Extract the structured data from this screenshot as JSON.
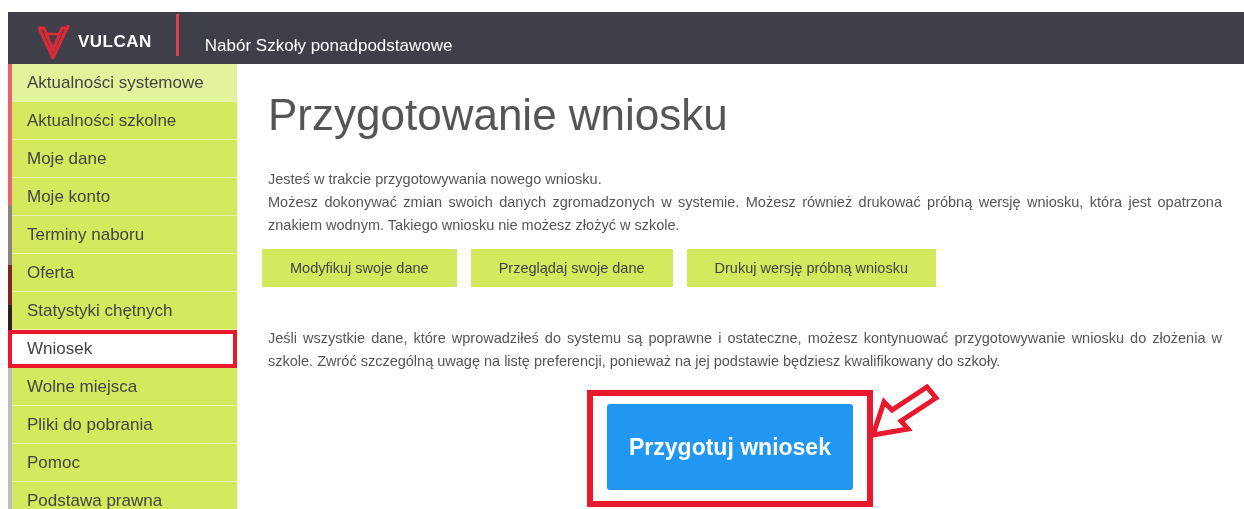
{
  "header": {
    "logo": "VULCAN",
    "title": "Nabór Szkoły ponadpodstawowe"
  },
  "sidebar": {
    "items": [
      {
        "label": "Aktualności systemowe",
        "selected": false,
        "kind": "news"
      },
      {
        "label": "Aktualności szkolne",
        "selected": false,
        "kind": "link"
      },
      {
        "label": "Moje dane",
        "selected": false,
        "kind": "link"
      },
      {
        "label": "Moje konto",
        "selected": false,
        "kind": "link"
      },
      {
        "label": "Terminy naboru",
        "selected": false,
        "kind": "link"
      },
      {
        "label": "Oferta",
        "selected": false,
        "kind": "link"
      },
      {
        "label": "Statystyki chętnych",
        "selected": false,
        "kind": "link"
      },
      {
        "label": "Wniosek",
        "selected": true,
        "kind": "link"
      },
      {
        "label": "Wolne miejsca",
        "selected": false,
        "kind": "link"
      },
      {
        "label": "Pliki do pobrania",
        "selected": false,
        "kind": "link"
      },
      {
        "label": "Pomoc",
        "selected": false,
        "kind": "link"
      },
      {
        "label": "Podstawa prawna",
        "selected": false,
        "kind": "link"
      }
    ]
  },
  "main": {
    "title": "Przygotowanie wniosku",
    "intro": [
      "Jesteś w trakcie przygotowywania nowego wniosku.",
      "Możesz dokonywać zmian swoich danych zgromadzonych w systemie. Możesz również drukować próbną wersję wniosku, która jest opatrzona znakiem wodnym. Takiego wniosku nie możesz złożyć w szkole."
    ],
    "buttons": [
      "Modyfikuj swoje dane",
      "Przeglądaj swoje dane",
      "Drukuj wersję próbną wniosku"
    ],
    "note": "Jeśli wszystkie dane, które wprowadziłeś do systemu są poprawne i ostateczne, możesz kontynuować przygotowywanie wniosku do złożenia w szkole. Zwróć szczególną uwagę na listę preferencji, ponieważ na jej podstawie będziesz kwalifikowany do szkoły.",
    "primary_button": {
      "label": "Przygotuj wniosek",
      "highlighted": true
    }
  }
}
